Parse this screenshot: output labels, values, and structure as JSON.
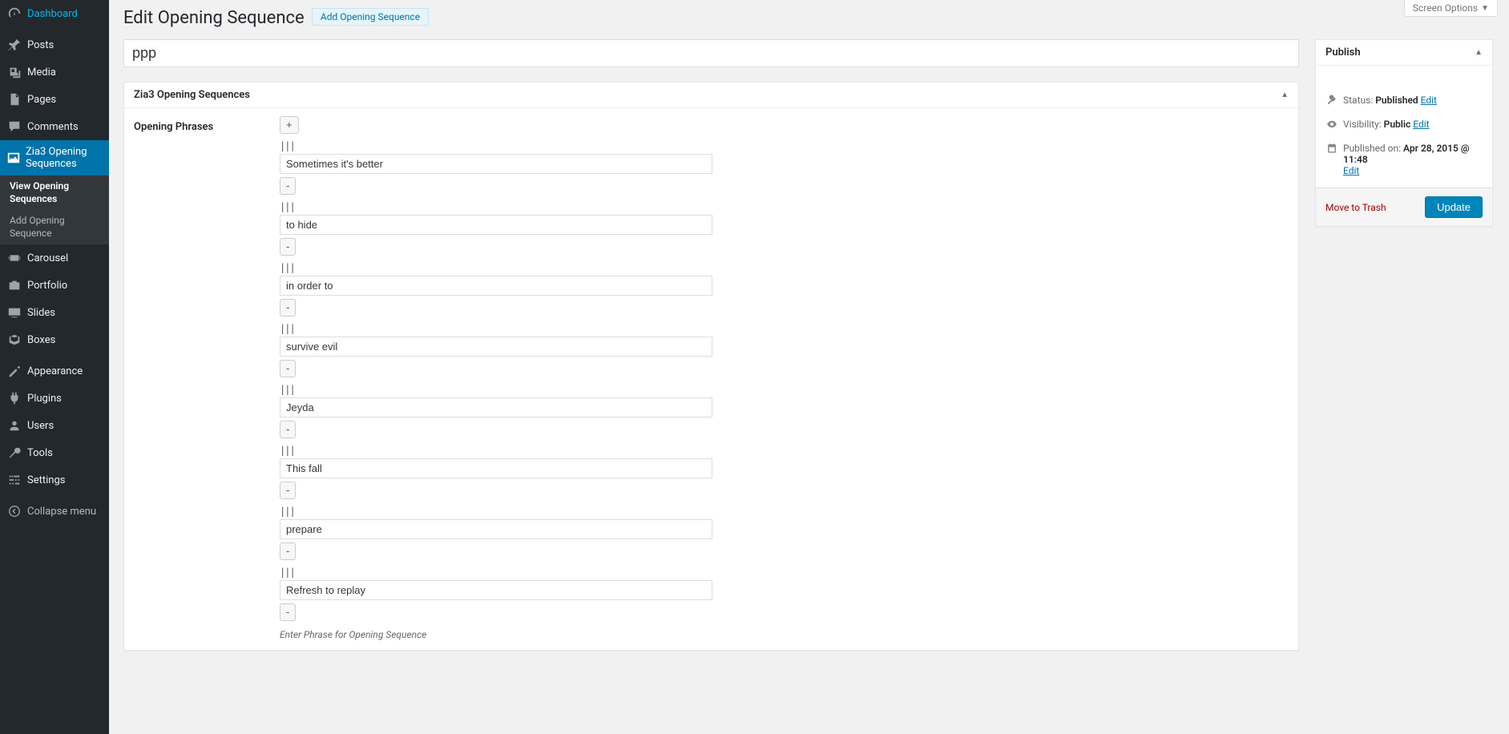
{
  "screenOptions": "Screen Options",
  "page": {
    "title": "Edit Opening Sequence",
    "addNew": "Add Opening Sequence"
  },
  "menu": [
    {
      "icon": "dashboard",
      "label": "Dashboard"
    },
    {
      "sep": true
    },
    {
      "icon": "pin",
      "label": "Posts"
    },
    {
      "icon": "media",
      "label": "Media"
    },
    {
      "icon": "page",
      "label": "Pages"
    },
    {
      "icon": "comment",
      "label": "Comments"
    },
    {
      "icon": "image",
      "label": "Zia3 Opening Sequences",
      "current": true,
      "submenu": [
        {
          "label": "View Opening Sequences",
          "current": true
        },
        {
          "label": "Add Opening Sequence"
        }
      ]
    },
    {
      "icon": "carousel",
      "label": "Carousel"
    },
    {
      "icon": "portfolio",
      "label": "Portfolio"
    },
    {
      "icon": "slides",
      "label": "Slides"
    },
    {
      "icon": "box",
      "label": "Boxes"
    },
    {
      "sep": true
    },
    {
      "icon": "appearance",
      "label": "Appearance"
    },
    {
      "icon": "plugin",
      "label": "Plugins"
    },
    {
      "icon": "users",
      "label": "Users"
    },
    {
      "icon": "tools",
      "label": "Tools"
    },
    {
      "icon": "settings",
      "label": "Settings"
    },
    {
      "sep": true
    },
    {
      "icon": "collapse",
      "label": "Collapse menu",
      "collapse": true
    }
  ],
  "post": {
    "title": "ppp"
  },
  "metabox": {
    "title": "Zia3 Opening Sequences",
    "fieldLabel": "Opening Phrases",
    "addBtn": "+",
    "removeBtn": "-",
    "dragHandle": "|||",
    "phrases": [
      "Sometimes it's better",
      "to hide",
      "in order to",
      "survive evil",
      "Jeyda",
      "This fall",
      "prepare",
      "Refresh to replay"
    ],
    "help": "Enter Phrase for Opening Sequence"
  },
  "publish": {
    "boxTitle": "Publish",
    "statusLabel": "Status:",
    "statusValue": "Published",
    "visibilityLabel": "Visibility:",
    "visibilityValue": "Public",
    "publishedLabel": "Published on:",
    "publishedValue": "Apr 28, 2015 @ 11:48",
    "editLink": "Edit",
    "trash": "Move to Trash",
    "update": "Update"
  }
}
